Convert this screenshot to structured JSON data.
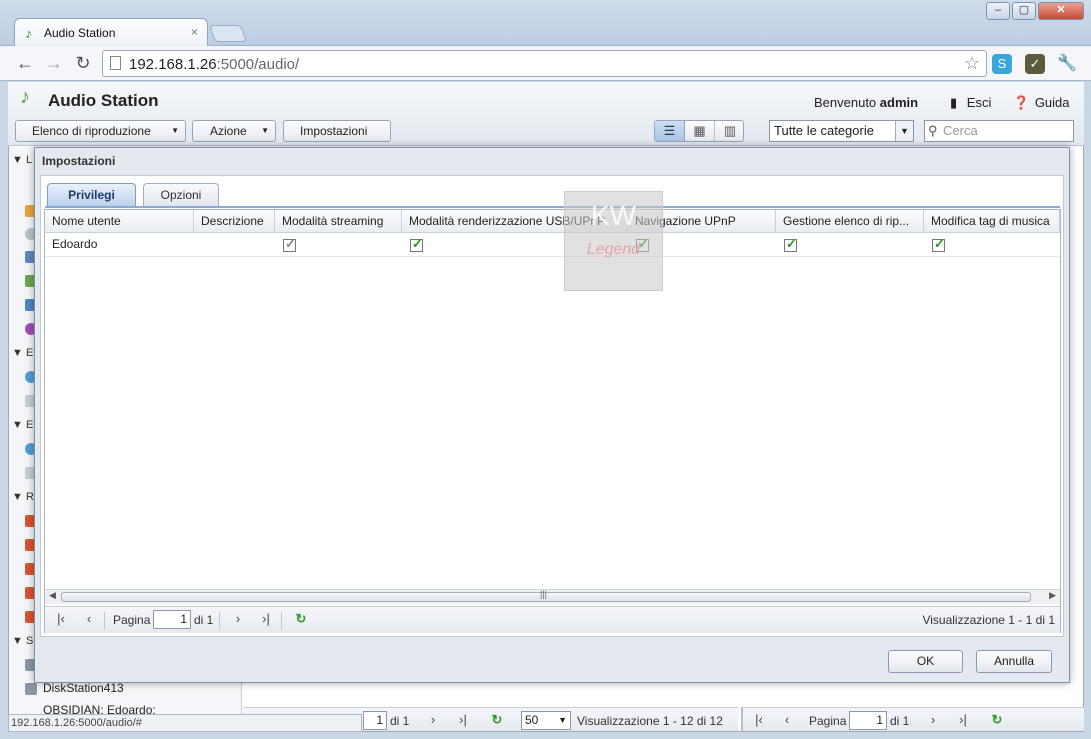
{
  "browser": {
    "tab_title": "Audio Station",
    "tab_close": "×",
    "url_host": "192.168.1.26",
    "url_rest": ":5000/audio/",
    "status_url": "192.168.1.26:5000/audio/#"
  },
  "app": {
    "title": "Audio Station",
    "welcome_prefix": "Benvenuto",
    "welcome_user": "admin",
    "logout": "Esci",
    "help": "Guida",
    "playlist_button": "Elenco di riproduzione",
    "action_button": "Azione",
    "settings_button": "Impostazioni",
    "category_select": "Tutte le categorie",
    "search_placeholder": "Cerca"
  },
  "sidebar": {
    "letters": [
      "L",
      "E",
      "E",
      "R",
      "S"
    ],
    "items": [
      "DiskStation413",
      "OBSIDIAN: Edoardo:"
    ]
  },
  "bottom_pager": {
    "page_value": "1",
    "of_text": "di 1",
    "per_page": "50",
    "display": "Visualizzazione 1 - 12 di 12",
    "page_label": "Pagina",
    "page_value2": "1",
    "of_text2": "di 1"
  },
  "dialog": {
    "title": "Impostazioni",
    "tabs": [
      {
        "label": "Privilegi",
        "active": true
      },
      {
        "label": "Opzioni",
        "active": false
      }
    ],
    "columns": [
      "Nome utente",
      "Descrizione",
      "Modalità streaming",
      "Modalità renderizzazione USB/UPnP",
      "Navigazione UPnP",
      "Gestione elenco di rip...",
      "Modifica tag di musica"
    ],
    "rows": [
      {
        "user": "Edoardo",
        "description": "",
        "streaming": true,
        "usb_upnp": true,
        "upnp_nav": true,
        "playlist_mgmt": true,
        "tag_edit": true
      }
    ],
    "pager": {
      "page_label": "Pagina",
      "page_value": "1",
      "of_text": "di 1",
      "display": "Visualizzazione 1 - 1 di 1"
    },
    "ok": "OK",
    "cancel": "Annulla"
  },
  "watermark": {
    "top": "KW",
    "bottom": "Legend"
  }
}
